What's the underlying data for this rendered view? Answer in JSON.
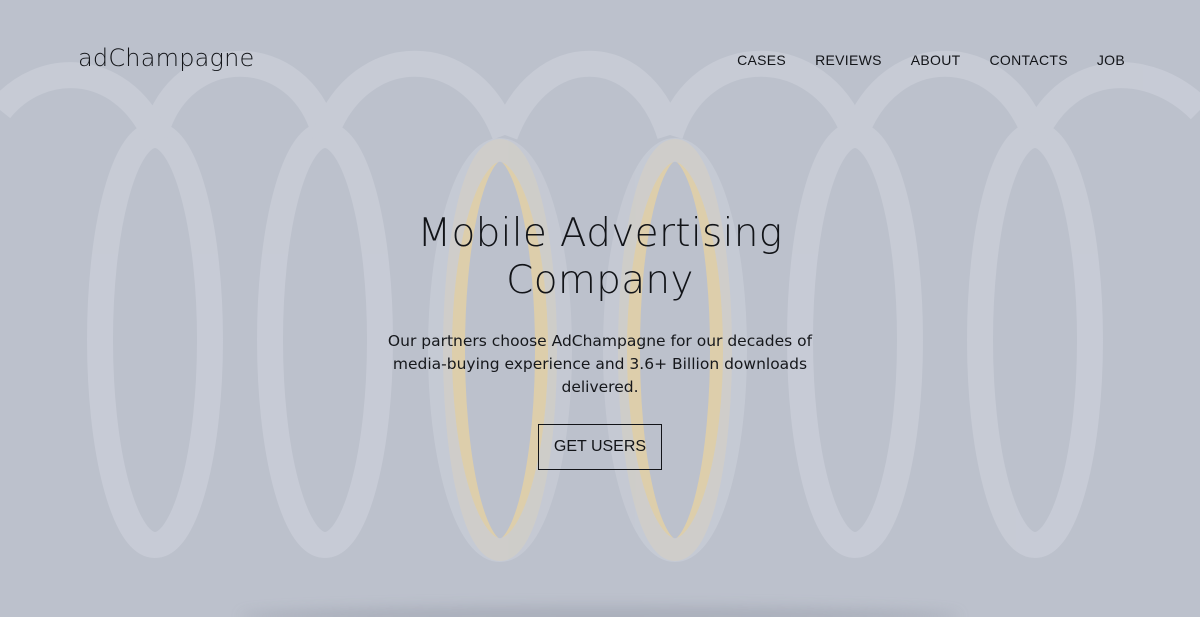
{
  "brand": {
    "logo_text": "adChampagne"
  },
  "nav": {
    "items": [
      {
        "label": "CASES"
      },
      {
        "label": "REVIEWS"
      },
      {
        "label": "ABOUT"
      },
      {
        "label": "CONTACTS"
      },
      {
        "label": "JOB"
      }
    ]
  },
  "hero": {
    "title_line1": "Mobile Advertising",
    "title_line2": "Company",
    "subtitle": "Our partners choose AdChampagne for our decades of media-buying experience and 3.6+ Billion downloads delivered.",
    "cta_label": "GET USERS"
  },
  "colors": {
    "background": "#bcc1cc",
    "loop_stroke": "#c8ccd6",
    "accent_gold": "#f0d6a0",
    "text": "#121418"
  }
}
